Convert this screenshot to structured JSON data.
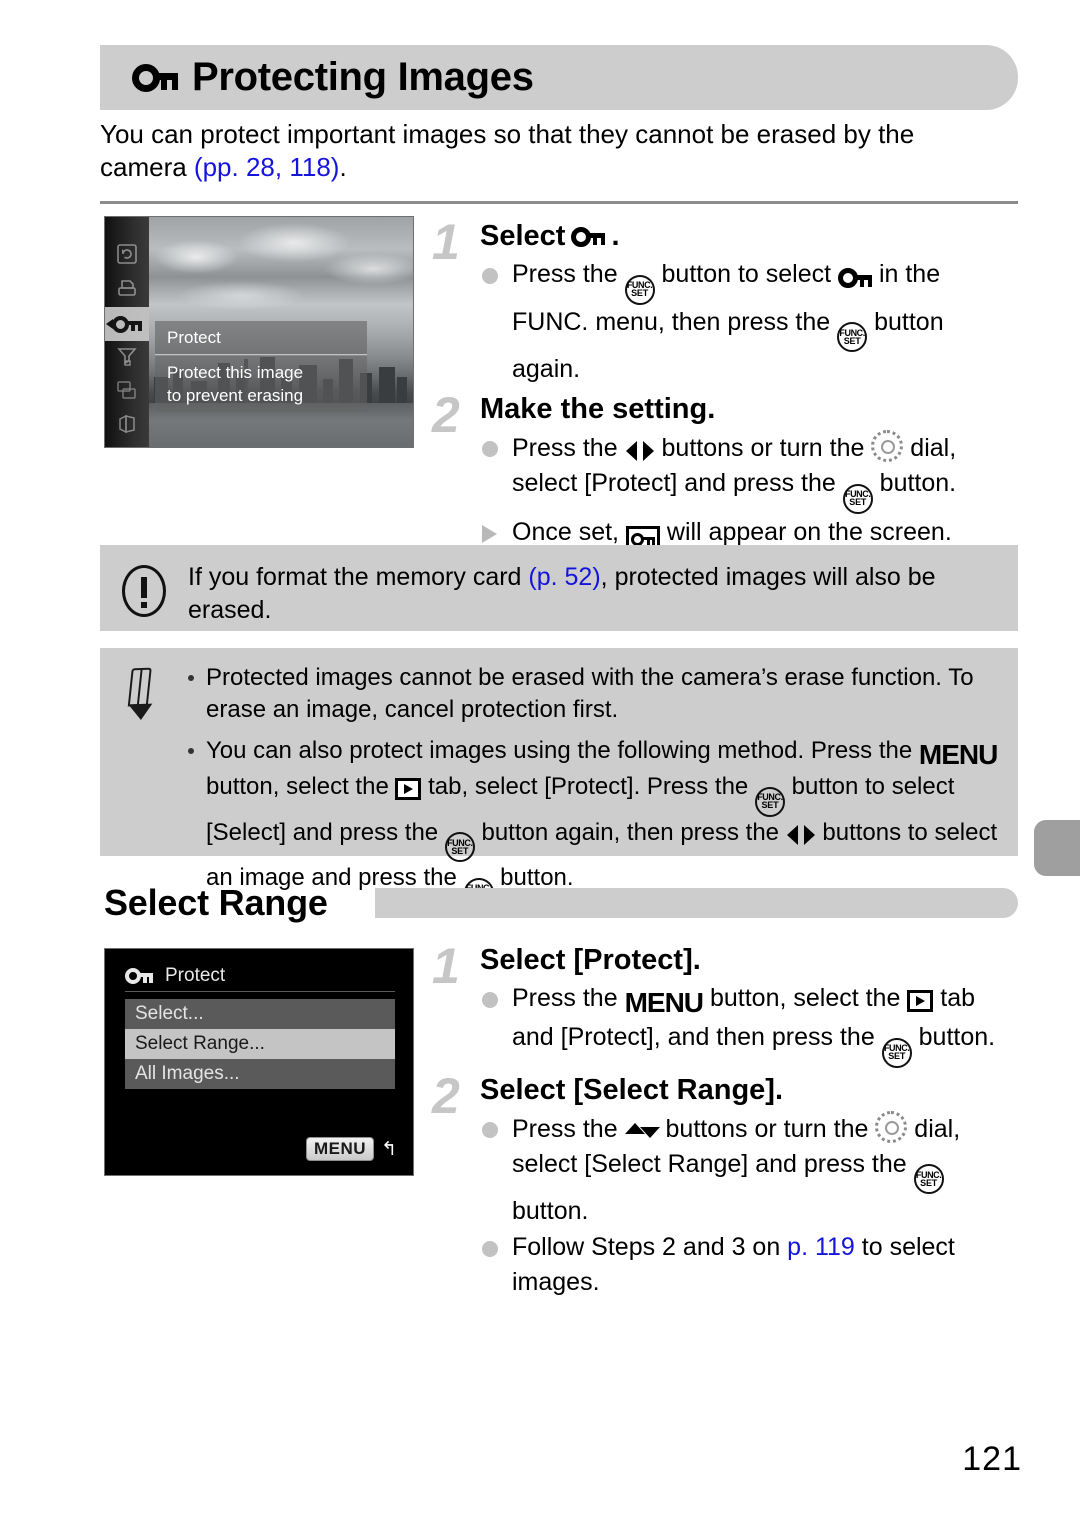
{
  "header": {
    "title": "Protecting Images",
    "icon": "key-icon"
  },
  "intro": {
    "line1": "You can protect important images so that they cannot be erased by the",
    "line2_pre": "camera ",
    "ref_open": "(",
    "ref1": "pp. 28",
    "ref_sep": ", ",
    "ref2": "118",
    "ref_close": ")",
    "line2_post": "."
  },
  "screen1": {
    "func_menu_items": [
      "rotate-icon",
      "print-icon",
      "protect-key-icon",
      "favorites-icon",
      "transition-icon",
      "slideshow-icon"
    ],
    "selected_item": "protect-key-icon",
    "title": "Protect",
    "description_line1": "Protect this image",
    "description_line2": "to prevent erasing"
  },
  "screen2": {
    "title": "Protect",
    "title_icon": "key-icon",
    "items": [
      "Select...",
      "Select Range...",
      "All Images..."
    ],
    "selected_item": "Select Range...",
    "menu_chip": "MENU",
    "return_glyph": "↰"
  },
  "steps1": [
    {
      "number": "1",
      "title_pre": "Select ",
      "title_icon": "key-icon",
      "title_post": ".",
      "bullets": [
        {
          "type": "dot",
          "parts": [
            {
              "t": "text",
              "v": "Press the "
            },
            {
              "t": "icon",
              "v": "func-set-button-icon"
            },
            {
              "t": "text",
              "v": " button to select "
            },
            {
              "t": "icon",
              "v": "key-icon"
            },
            {
              "t": "text",
              "v": " in the FUNC. menu, then press the "
            },
            {
              "t": "icon",
              "v": "func-set-button-icon"
            },
            {
              "t": "text",
              "v": " button again."
            }
          ]
        }
      ]
    },
    {
      "number": "2",
      "title_pre": "Make the setting.",
      "title_icon": "",
      "title_post": "",
      "bullets": [
        {
          "type": "dot",
          "parts": [
            {
              "t": "text",
              "v": "Press the "
            },
            {
              "t": "icon",
              "v": "left-right-buttons-icon"
            },
            {
              "t": "text",
              "v": " buttons or turn the "
            },
            {
              "t": "icon",
              "v": "control-dial-icon"
            },
            {
              "t": "text",
              "v": " dial, select [Protect] and press the "
            },
            {
              "t": "icon",
              "v": "func-set-button-icon"
            },
            {
              "t": "text",
              "v": " button."
            }
          ]
        },
        {
          "type": "triangle",
          "parts": [
            {
              "t": "text",
              "v": "Once set, "
            },
            {
              "t": "icon",
              "v": "boxed-key-icon"
            },
            {
              "t": "text",
              "v": " will appear on the screen."
            }
          ]
        }
      ]
    }
  ],
  "caution": {
    "icon": "exclamation-icon",
    "pre": "If you format the memory card ",
    "ref": "(p. 52)",
    "post": ", protected images will also be erased."
  },
  "notes": {
    "icon": "pencil-icon",
    "items": [
      {
        "parts": [
          {
            "t": "text",
            "v": "Protected images cannot be erased with the camera’s erase function. To erase an image, cancel protection first."
          }
        ]
      },
      {
        "parts": [
          {
            "t": "text",
            "v": "You can also protect images using the following method. Press the "
          },
          {
            "t": "icon",
            "v": "menu-word-icon"
          },
          {
            "t": "text",
            "v": " button, select the "
          },
          {
            "t": "icon",
            "v": "playback-tab-icon"
          },
          {
            "t": "text",
            "v": " tab, select [Protect]. Press the "
          },
          {
            "t": "icon",
            "v": "func-set-button-icon"
          },
          {
            "t": "text",
            "v": " button to select [Select] and press the "
          },
          {
            "t": "icon",
            "v": "func-set-button-icon"
          },
          {
            "t": "text",
            "v": " button again, then press the "
          },
          {
            "t": "icon",
            "v": "left-right-buttons-icon"
          },
          {
            "t": "text",
            "v": " buttons to select an image and press the "
          },
          {
            "t": "icon",
            "v": "func-set-button-icon"
          },
          {
            "t": "text",
            "v": " button."
          }
        ]
      }
    ]
  },
  "section": {
    "title": "Select Range"
  },
  "steps2": [
    {
      "number": "1",
      "title_pre": "Select [Protect].",
      "title_icon": "",
      "title_post": "",
      "bullets": [
        {
          "type": "dot",
          "parts": [
            {
              "t": "text",
              "v": "Press the "
            },
            {
              "t": "icon",
              "v": "menu-word-icon"
            },
            {
              "t": "text",
              "v": " button, select the "
            },
            {
              "t": "icon",
              "v": "playback-tab-icon"
            },
            {
              "t": "text",
              "v": " tab and [Protect], and then press the "
            },
            {
              "t": "icon",
              "v": "func-set-button-icon"
            },
            {
              "t": "text",
              "v": " button."
            }
          ]
        }
      ]
    },
    {
      "number": "2",
      "title_pre": "Select [Select Range].",
      "title_icon": "",
      "title_post": "",
      "bullets": [
        {
          "type": "dot",
          "parts": [
            {
              "t": "text",
              "v": "Press the "
            },
            {
              "t": "icon",
              "v": "up-down-buttons-icon"
            },
            {
              "t": "text",
              "v": " buttons or turn the "
            },
            {
              "t": "icon",
              "v": "control-dial-icon"
            },
            {
              "t": "text",
              "v": " dial, select [Select Range] and press the "
            },
            {
              "t": "icon",
              "v": "func-set-button-icon"
            },
            {
              "t": "text",
              "v": " button."
            }
          ]
        },
        {
          "type": "dot",
          "parts": [
            {
              "t": "text",
              "v": "Follow Steps 2 and 3 on "
            },
            {
              "t": "link",
              "v": "p. 119"
            },
            {
              "t": "text",
              "v": " to select images."
            }
          ]
        }
      ]
    }
  ],
  "footer": {
    "page_number": "121"
  },
  "colors": {
    "band": "#cdcdcd",
    "link": "#1414dc",
    "step_number": "#c6c6c6",
    "bullet_dot": "#c2c2c2"
  }
}
